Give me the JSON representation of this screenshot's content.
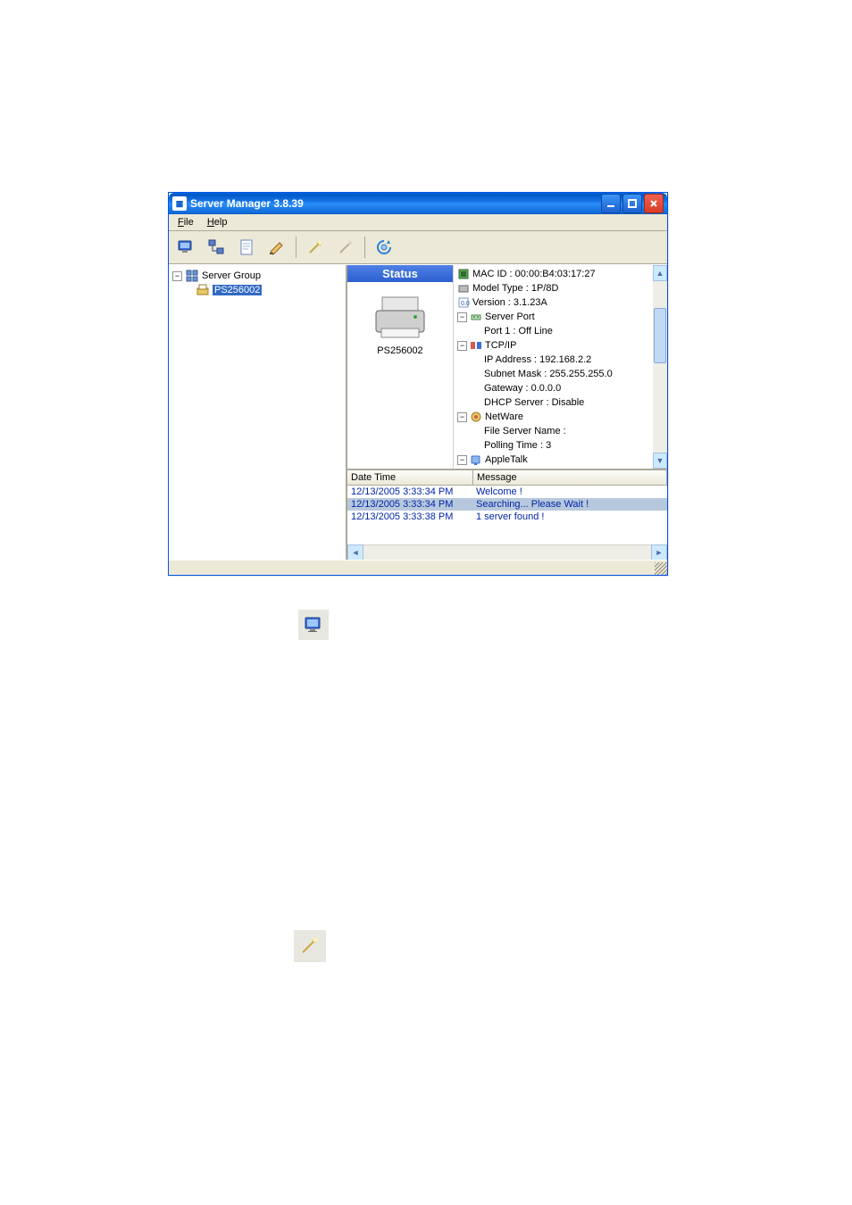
{
  "window": {
    "title": "Server Manager 3.8.39"
  },
  "menu": {
    "file": "File",
    "help": "Help"
  },
  "tree": {
    "root": "Server Group",
    "node1": "PS256002"
  },
  "status": {
    "header": "Status",
    "device": "PS256002"
  },
  "details": {
    "mac": "MAC ID : 00:00:B4:03:17:27",
    "model": "Model Type : 1P/8D",
    "version": "Version : 3.1.23A",
    "serverport": "Server Port",
    "port1": "Port 1 : Off Line",
    "tcpip": "TCP/IP",
    "ip": "IP Address : 192.168.2.2",
    "subnet": "Subnet Mask : 255.255.255.0",
    "gateway": "Gateway : 0.0.0.0",
    "dhcp": "DHCP Server : Disable",
    "netware": "NetWare",
    "fsname": "File Server Name :",
    "polling": "Polling Time : 3",
    "appletalk": "AppleTalk"
  },
  "log": {
    "hdr_dt": "Date Time",
    "hdr_msg": "Message",
    "rows": [
      {
        "dt": "12/13/2005 3:33:34 PM",
        "msg": "Welcome !"
      },
      {
        "dt": "12/13/2005 3:33:34 PM",
        "msg": "Searching... Please Wait !"
      },
      {
        "dt": "12/13/2005 3:33:38 PM",
        "msg": "1 server found !"
      }
    ]
  }
}
